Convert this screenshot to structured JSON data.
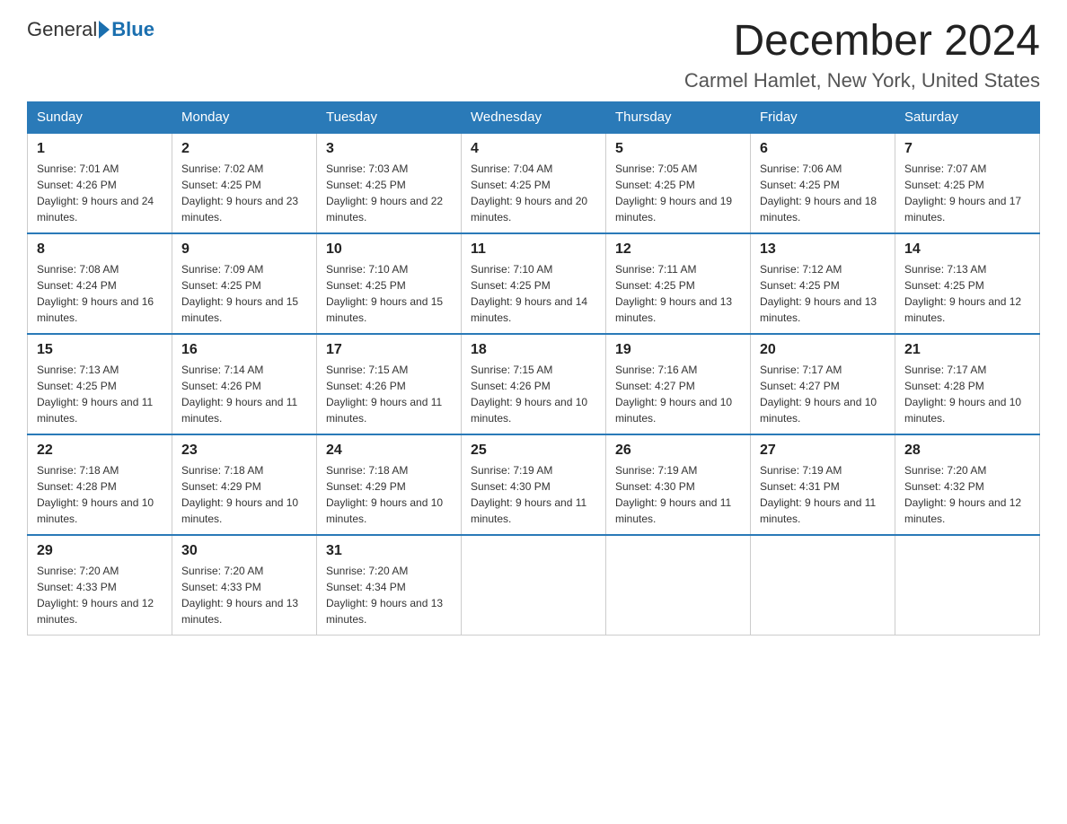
{
  "header": {
    "logo_general": "General",
    "logo_blue": "Blue",
    "title": "December 2024",
    "subtitle": "Carmel Hamlet, New York, United States"
  },
  "weekdays": [
    "Sunday",
    "Monday",
    "Tuesday",
    "Wednesday",
    "Thursday",
    "Friday",
    "Saturday"
  ],
  "weeks": [
    [
      {
        "day": "1",
        "sunrise": "Sunrise: 7:01 AM",
        "sunset": "Sunset: 4:26 PM",
        "daylight": "Daylight: 9 hours and 24 minutes."
      },
      {
        "day": "2",
        "sunrise": "Sunrise: 7:02 AM",
        "sunset": "Sunset: 4:25 PM",
        "daylight": "Daylight: 9 hours and 23 minutes."
      },
      {
        "day": "3",
        "sunrise": "Sunrise: 7:03 AM",
        "sunset": "Sunset: 4:25 PM",
        "daylight": "Daylight: 9 hours and 22 minutes."
      },
      {
        "day": "4",
        "sunrise": "Sunrise: 7:04 AM",
        "sunset": "Sunset: 4:25 PM",
        "daylight": "Daylight: 9 hours and 20 minutes."
      },
      {
        "day": "5",
        "sunrise": "Sunrise: 7:05 AM",
        "sunset": "Sunset: 4:25 PM",
        "daylight": "Daylight: 9 hours and 19 minutes."
      },
      {
        "day": "6",
        "sunrise": "Sunrise: 7:06 AM",
        "sunset": "Sunset: 4:25 PM",
        "daylight": "Daylight: 9 hours and 18 minutes."
      },
      {
        "day": "7",
        "sunrise": "Sunrise: 7:07 AM",
        "sunset": "Sunset: 4:25 PM",
        "daylight": "Daylight: 9 hours and 17 minutes."
      }
    ],
    [
      {
        "day": "8",
        "sunrise": "Sunrise: 7:08 AM",
        "sunset": "Sunset: 4:24 PM",
        "daylight": "Daylight: 9 hours and 16 minutes."
      },
      {
        "day": "9",
        "sunrise": "Sunrise: 7:09 AM",
        "sunset": "Sunset: 4:25 PM",
        "daylight": "Daylight: 9 hours and 15 minutes."
      },
      {
        "day": "10",
        "sunrise": "Sunrise: 7:10 AM",
        "sunset": "Sunset: 4:25 PM",
        "daylight": "Daylight: 9 hours and 15 minutes."
      },
      {
        "day": "11",
        "sunrise": "Sunrise: 7:10 AM",
        "sunset": "Sunset: 4:25 PM",
        "daylight": "Daylight: 9 hours and 14 minutes."
      },
      {
        "day": "12",
        "sunrise": "Sunrise: 7:11 AM",
        "sunset": "Sunset: 4:25 PM",
        "daylight": "Daylight: 9 hours and 13 minutes."
      },
      {
        "day": "13",
        "sunrise": "Sunrise: 7:12 AM",
        "sunset": "Sunset: 4:25 PM",
        "daylight": "Daylight: 9 hours and 13 minutes."
      },
      {
        "day": "14",
        "sunrise": "Sunrise: 7:13 AM",
        "sunset": "Sunset: 4:25 PM",
        "daylight": "Daylight: 9 hours and 12 minutes."
      }
    ],
    [
      {
        "day": "15",
        "sunrise": "Sunrise: 7:13 AM",
        "sunset": "Sunset: 4:25 PM",
        "daylight": "Daylight: 9 hours and 11 minutes."
      },
      {
        "day": "16",
        "sunrise": "Sunrise: 7:14 AM",
        "sunset": "Sunset: 4:26 PM",
        "daylight": "Daylight: 9 hours and 11 minutes."
      },
      {
        "day": "17",
        "sunrise": "Sunrise: 7:15 AM",
        "sunset": "Sunset: 4:26 PM",
        "daylight": "Daylight: 9 hours and 11 minutes."
      },
      {
        "day": "18",
        "sunrise": "Sunrise: 7:15 AM",
        "sunset": "Sunset: 4:26 PM",
        "daylight": "Daylight: 9 hours and 10 minutes."
      },
      {
        "day": "19",
        "sunrise": "Sunrise: 7:16 AM",
        "sunset": "Sunset: 4:27 PM",
        "daylight": "Daylight: 9 hours and 10 minutes."
      },
      {
        "day": "20",
        "sunrise": "Sunrise: 7:17 AM",
        "sunset": "Sunset: 4:27 PM",
        "daylight": "Daylight: 9 hours and 10 minutes."
      },
      {
        "day": "21",
        "sunrise": "Sunrise: 7:17 AM",
        "sunset": "Sunset: 4:28 PM",
        "daylight": "Daylight: 9 hours and 10 minutes."
      }
    ],
    [
      {
        "day": "22",
        "sunrise": "Sunrise: 7:18 AM",
        "sunset": "Sunset: 4:28 PM",
        "daylight": "Daylight: 9 hours and 10 minutes."
      },
      {
        "day": "23",
        "sunrise": "Sunrise: 7:18 AM",
        "sunset": "Sunset: 4:29 PM",
        "daylight": "Daylight: 9 hours and 10 minutes."
      },
      {
        "day": "24",
        "sunrise": "Sunrise: 7:18 AM",
        "sunset": "Sunset: 4:29 PM",
        "daylight": "Daylight: 9 hours and 10 minutes."
      },
      {
        "day": "25",
        "sunrise": "Sunrise: 7:19 AM",
        "sunset": "Sunset: 4:30 PM",
        "daylight": "Daylight: 9 hours and 11 minutes."
      },
      {
        "day": "26",
        "sunrise": "Sunrise: 7:19 AM",
        "sunset": "Sunset: 4:30 PM",
        "daylight": "Daylight: 9 hours and 11 minutes."
      },
      {
        "day": "27",
        "sunrise": "Sunrise: 7:19 AM",
        "sunset": "Sunset: 4:31 PM",
        "daylight": "Daylight: 9 hours and 11 minutes."
      },
      {
        "day": "28",
        "sunrise": "Sunrise: 7:20 AM",
        "sunset": "Sunset: 4:32 PM",
        "daylight": "Daylight: 9 hours and 12 minutes."
      }
    ],
    [
      {
        "day": "29",
        "sunrise": "Sunrise: 7:20 AM",
        "sunset": "Sunset: 4:33 PM",
        "daylight": "Daylight: 9 hours and 12 minutes."
      },
      {
        "day": "30",
        "sunrise": "Sunrise: 7:20 AM",
        "sunset": "Sunset: 4:33 PM",
        "daylight": "Daylight: 9 hours and 13 minutes."
      },
      {
        "day": "31",
        "sunrise": "Sunrise: 7:20 AM",
        "sunset": "Sunset: 4:34 PM",
        "daylight": "Daylight: 9 hours and 13 minutes."
      },
      null,
      null,
      null,
      null
    ]
  ]
}
